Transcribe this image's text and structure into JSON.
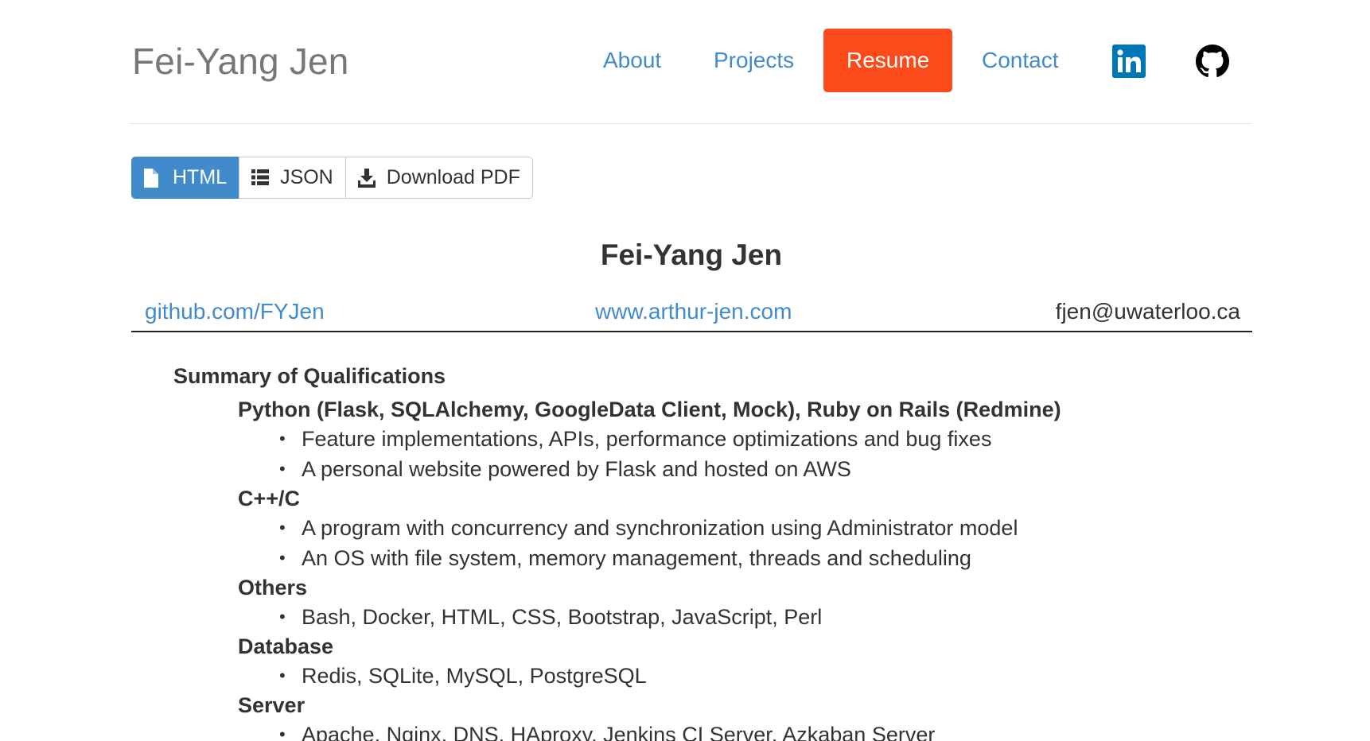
{
  "header": {
    "brand": "Fei-Yang Jen",
    "nav": [
      {
        "label": "About"
      },
      {
        "label": "Projects"
      },
      {
        "label": "Resume"
      },
      {
        "label": "Contact"
      }
    ],
    "social": [
      {
        "icon": "linkedin-icon",
        "color": "#0077b5"
      },
      {
        "icon": "github-icon",
        "color": "#000000"
      }
    ],
    "active_color": "#fc4a1a",
    "link_color": "#428bca"
  },
  "format_buttons": [
    {
      "label": "HTML",
      "icon": "file-icon",
      "active": true
    },
    {
      "label": "JSON",
      "icon": "list-icon",
      "active": false
    },
    {
      "label": "Download PDF",
      "icon": "download-icon",
      "active": false
    }
  ],
  "resume": {
    "name": "Fei-Yang Jen",
    "github": "github.com/FYJen",
    "website": "www.arthur-jen.com",
    "email": "fjen@uwaterloo.ca",
    "summary_title": "Summary of Qualifications",
    "categories": [
      {
        "title": "Python (Flask, SQLAlchemy, GoogleData Client, Mock), Ruby on Rails (Redmine)",
        "items": [
          "Feature implementations, APIs, performance optimizations and bug fixes",
          "A personal website powered by Flask and hosted on AWS"
        ]
      },
      {
        "title": "C++/C",
        "items": [
          "A program with concurrency and synchronization using Administrator model",
          "An OS with file system, memory management, threads and scheduling"
        ]
      },
      {
        "title": "Others",
        "items": [
          "Bash, Docker, HTML, CSS, Bootstrap, JavaScript, Perl"
        ]
      },
      {
        "title": "Database",
        "items": [
          "Redis, SQLite, MySQL, PostgreSQL"
        ]
      },
      {
        "title": "Server",
        "items": [
          "Apache, Nginx, DNS, HAproxy, Jenkins CI Server, Azkaban Server"
        ]
      }
    ]
  }
}
